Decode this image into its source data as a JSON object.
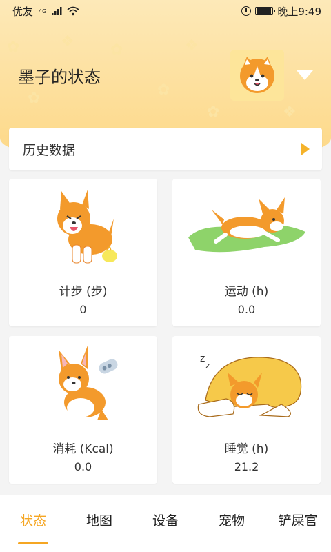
{
  "status_bar": {
    "carrier": "优友",
    "network_tag": "4G",
    "time": "晚上9:49",
    "battery_level": 0.85
  },
  "header": {
    "title": "墨子的状态"
  },
  "history": {
    "label": "历史数据"
  },
  "stats": [
    {
      "label": "计步 (步)",
      "value": "0"
    },
    {
      "label": "运动 (h)",
      "value": "0.0"
    },
    {
      "label": "消耗 (Kcal)",
      "value": "0.0"
    },
    {
      "label": "睡觉 (h)",
      "value": "21.2"
    }
  ],
  "tabs": [
    {
      "label": "状态",
      "active": true
    },
    {
      "label": "地图",
      "active": false
    },
    {
      "label": "设备",
      "active": false
    },
    {
      "label": "宠物",
      "active": false
    },
    {
      "label": "铲屎官",
      "active": false
    }
  ],
  "colors": {
    "accent": "#f5a623",
    "header_bg": "#fdd98a",
    "corgi_orange": "#f39a2c",
    "grass": "#8ed36a"
  }
}
